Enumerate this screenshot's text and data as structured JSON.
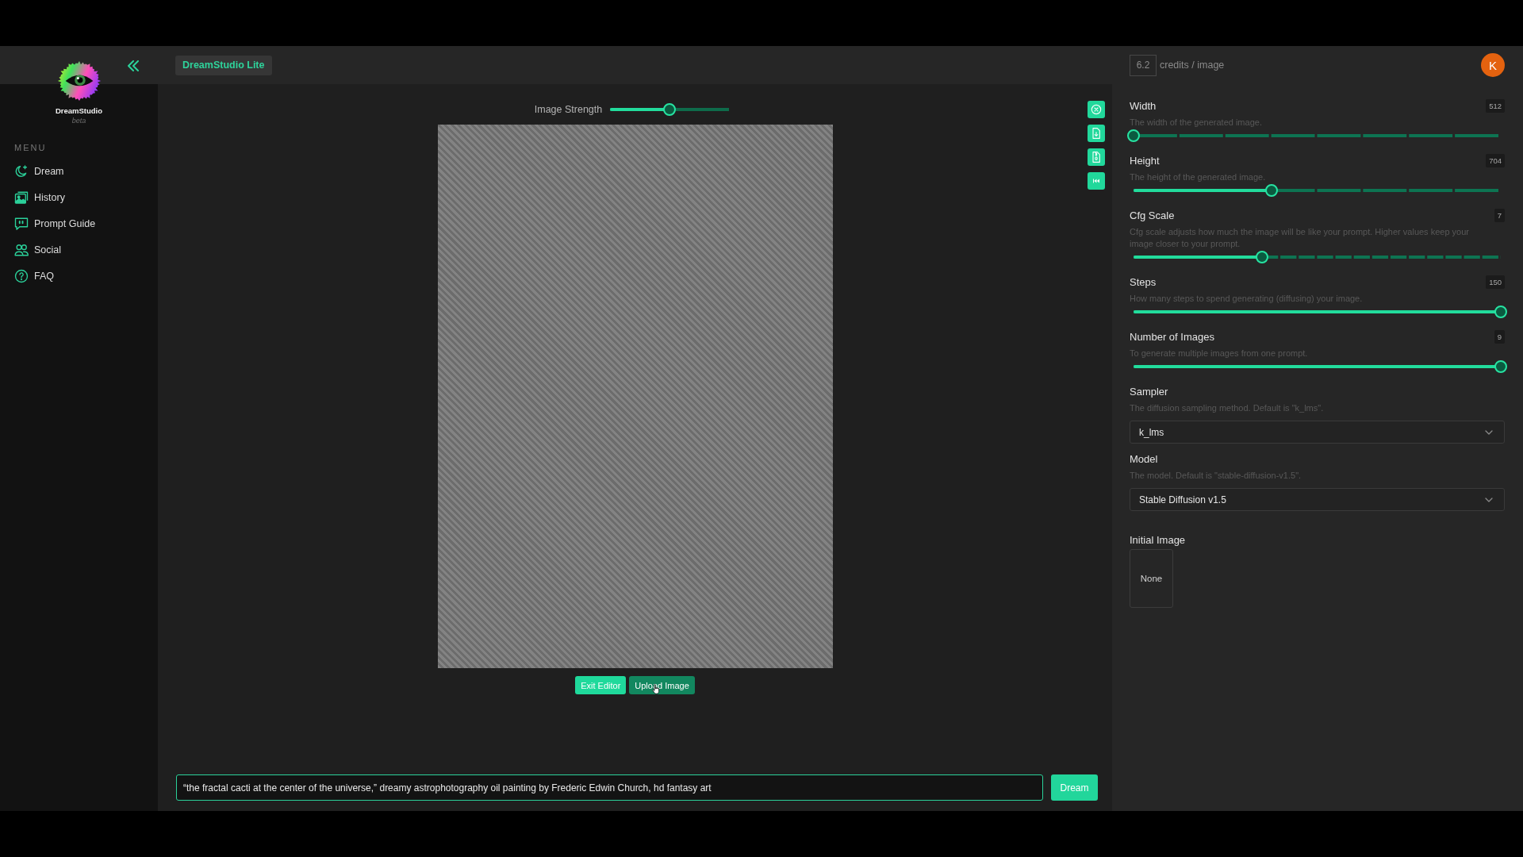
{
  "sidebar": {
    "brand": {
      "name": "DreamStudio",
      "tag": "beta"
    },
    "menu_heading": "MENU",
    "items": [
      {
        "label": "Dream",
        "selected": false
      },
      {
        "label": "History",
        "selected": false
      },
      {
        "label": "Prompt Guide",
        "selected": false
      },
      {
        "label": "Social",
        "selected": false
      },
      {
        "label": "FAQ",
        "selected": false
      }
    ]
  },
  "header": {
    "app_badge": "DreamStudio Lite",
    "credits": {
      "value": "6.2",
      "unit": "credits / image"
    },
    "avatar": "K"
  },
  "editor": {
    "strength": {
      "label": "Image Strength",
      "level": 0.5
    },
    "buttons": [
      {
        "label": "Exit Editor",
        "hovered": false
      },
      {
        "label": "Upload Image",
        "hovered": true
      }
    ]
  },
  "prompt": {
    "value": "“the fractal cacti at the center of the universe,” dreamy astrophotography oil painting by Frederic Edwin Church, hd fantasy art",
    "button": "Dream"
  },
  "settings": {
    "sliders": [
      {
        "kind": "coarse",
        "label": "Width",
        "value": "512",
        "description": "The width of the generated image.",
        "level": 0
      },
      {
        "kind": "coarse",
        "label": "Height",
        "value": "704",
        "description": "The height of the generated image.",
        "level": 0.375
      },
      {
        "kind": "fine",
        "label": "Cfg Scale",
        "value": "7",
        "description": "Cfg scale adjusts how much the image will be like your prompt. Higher values keep your image closer to your prompt.",
        "level": 0.35
      },
      {
        "kind": "plain",
        "label": "Steps",
        "value": "150",
        "description": "How many steps to spend generating (diffusing) your image.",
        "level": 1
      },
      {
        "kind": "plain",
        "label": "Number of Images",
        "value": "9",
        "description": "To generate multiple images from one prompt.",
        "level": 1
      }
    ],
    "selects": [
      {
        "label": "Sampler",
        "description": "The diffusion sampling method. Default is \"k_lms\".",
        "value": "k_lms"
      },
      {
        "label": "Model",
        "description": "The model. Default is \"stable-diffusion-v1.5\".",
        "value": "Stable Diffusion v1.5"
      }
    ],
    "initial_image": {
      "label": "Initial Image",
      "value": "None"
    }
  }
}
